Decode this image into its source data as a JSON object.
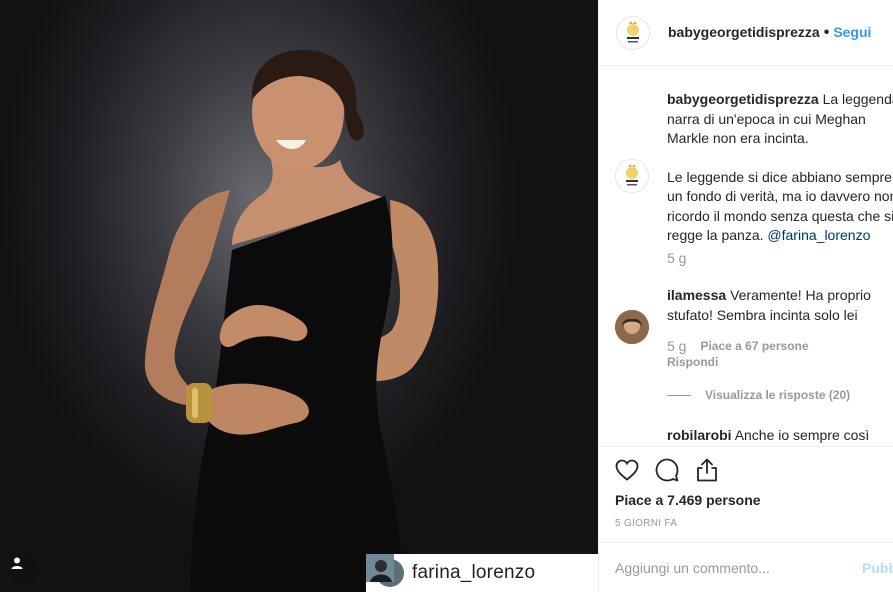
{
  "photo": {
    "alt_icons": [
      "user-tag-icon",
      "repost-icon"
    ],
    "repost": {
      "username": "farina_lorenzo"
    }
  },
  "header": {
    "username": "babygeorgetidisprezza",
    "separator": "•",
    "follow_label": "Segui"
  },
  "caption": {
    "username": "babygeorgetidisprezza",
    "text_1": "La leggenda narra di un'epoca in cui Meghan Markle non era incinta.",
    "text_2": "Le leggende si dice abbiano sempre un fondo di verità, ma io davvero non ricordo il mondo senza questa che si regge la panza.",
    "mention": "@farina_lorenzo",
    "time": "5 g"
  },
  "comments": [
    {
      "username": "ilamessa",
      "text": "Veramente! Ha proprio stufato! Sembra incinta solo lei",
      "time": "5 g",
      "likes": "Piace a 67 persone",
      "reply_label": "Rispondi",
      "view_replies": "Visualizza le risposte (20)"
    },
    {
      "username": "robilarobi",
      "text": "Anche io sempre così"
    }
  ],
  "actions": {
    "likes_text": "Piace a 7.469 persone",
    "date": "5 giorni fa"
  },
  "add_comment": {
    "placeholder": "Aggiungi un commento...",
    "publish_label": "Pubblica"
  },
  "colors": {
    "link": "#3897f0",
    "publish_disabled": "#b3dbff",
    "muted": "#999999",
    "text": "#262626"
  }
}
